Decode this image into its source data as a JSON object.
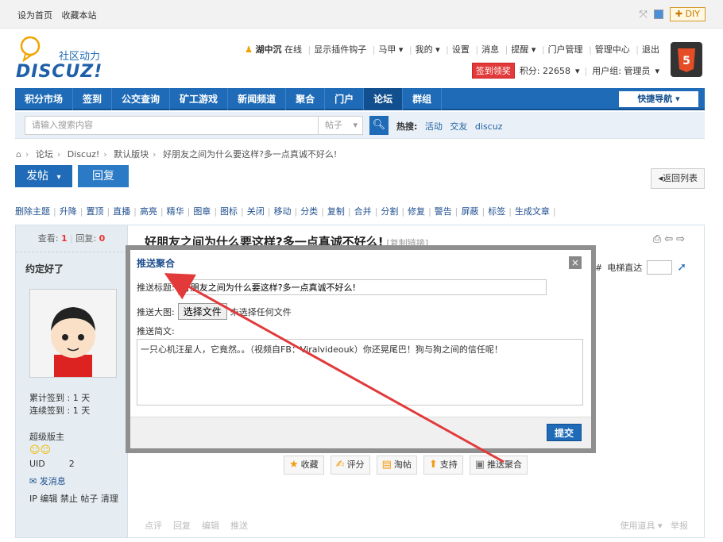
{
  "topbar": {
    "set_home": "设为首页",
    "bookmark": "收藏本站",
    "diy": "DIY"
  },
  "logo": {
    "tagline": "社区动力",
    "brand": "DISCUZ!"
  },
  "userbar": {
    "username": "湖中沉",
    "status": "在线",
    "items": [
      "显示插件钩子",
      "马甲",
      "我的",
      "设置",
      "消息",
      "提醒",
      "门户管理",
      "管理中心",
      "退出"
    ],
    "sign": "签到领奖",
    "points": "积分: 22658",
    "group": "用户组: 管理员"
  },
  "nav": {
    "items": [
      "积分市场",
      "签到",
      "公交查询",
      "矿工游戏",
      "新闻频道",
      "聚合",
      "门户",
      "论坛",
      "群组"
    ],
    "quick": "快捷导航"
  },
  "search": {
    "placeholder": "请输入搜索内容",
    "type": "帖子",
    "hot_label": "热搜:",
    "hot": [
      "活动",
      "交友",
      "discuz"
    ]
  },
  "breadcrumb": [
    "论坛",
    "Discuz!",
    "默认版块",
    "好朋友之间为什么要这样?多一点真诚不好么!"
  ],
  "buttons": {
    "post": "发帖",
    "reply": "回复",
    "back": "返回列表"
  },
  "modbar": [
    "删除主题",
    "升降",
    "置顶",
    "直播",
    "高亮",
    "精华",
    "图章",
    "图标",
    "关闭",
    "移动",
    "分类",
    "复制",
    "合并",
    "分割",
    "修复",
    "警告",
    "屏蔽",
    "标签",
    "生成文章"
  ],
  "post": {
    "view_label": "查看:",
    "views": "1",
    "reply_label": "回复:",
    "replies": "0",
    "author": "约定好了",
    "title": "好朋友之间为什么要这样?多一点真诚不好么!",
    "copy_link": "[复制链接]",
    "floor": "1#",
    "floor_jump": "电梯直达",
    "checkin_total": "累计签到 : 1 天",
    "checkin_streak": "连续签到 : 1 天",
    "role": "超级版主",
    "uid_label": "UID",
    "uid": "2",
    "message": "发消息",
    "admin_links": "IP 编辑 禁止 帖子 清理",
    "actions": [
      "收藏",
      "评分",
      "淘帖",
      "支持",
      "推送聚合"
    ],
    "bottom": [
      "点评",
      "回复",
      "编辑",
      "推送"
    ],
    "bottom_right": "使用道具",
    "report": "举报"
  },
  "dialog": {
    "title": "推送聚合",
    "title_label": "推送标题:",
    "title_value": "好朋友之间为什么要这样?多一点真诚不好么!",
    "image_label": "推送大图:",
    "file_button": "选择文件",
    "file_status": "未选择任何文件",
    "summary_label": "推送简文:",
    "summary": "一只心机汪星人，它竟然。。（视频自FB：Viralvideouk）你还晃尾巴！狗与狗之间的信任呢！",
    "submit": "提交",
    "close": "×"
  },
  "colors": {
    "brand": "#1f6bb7",
    "arrow": "#e23a3a"
  }
}
